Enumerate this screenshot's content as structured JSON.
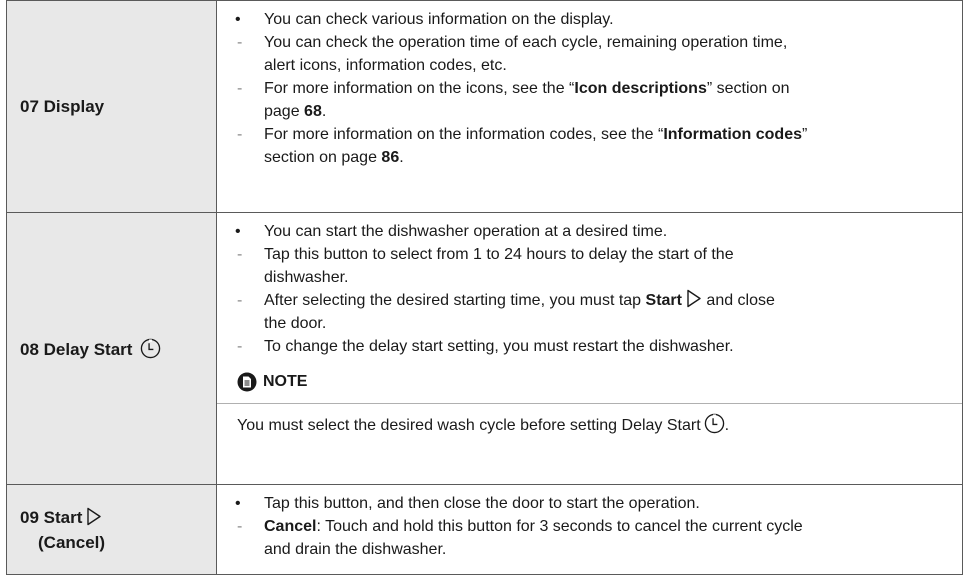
{
  "rows": [
    {
      "label": "07 Display",
      "bullet": "You can check various information on the display.",
      "d1": "You can check the operation time of each cycle, remaining operation time,",
      "d1b": "alert icons, information codes, etc.",
      "d2a": "For more information on the icons, see the “",
      "d2bold": "Icon descriptions",
      "d2b": "” section on",
      "d2c": "page ",
      "d2page": "68",
      "d2d": ".",
      "d3a": "For more information on the information codes, see the “",
      "d3bold": "Information codes",
      "d3b": "”",
      "d3c": "section on page ",
      "d3page": "86",
      "d3d": "."
    },
    {
      "label": "08 Delay Start",
      "bullet": "You can start the dishwasher operation at a desired time.",
      "d1": "Tap this button to select from 1 to 24 hours to delay the start of the",
      "d1b": "dishwasher.",
      "d2a": "After selecting the desired starting time, you must tap ",
      "d2bold": "Start",
      "d2b": " and close",
      "d2c": "the door.",
      "d3": "To change the delay start setting, you must restart the dishwasher.",
      "note_title": "NOTE",
      "note_text": "You must select the desired wash cycle before setting Delay Start",
      "note_end": "."
    },
    {
      "label_line1": "09 Start",
      "label_line2": "(Cancel)",
      "bullet": "Tap this button, and then close the door to start the operation.",
      "d1bold": "Cancel",
      "d1": ": Touch and hold this button for 3 seconds to cancel the current cycle",
      "d1b": "and drain the dishwasher."
    }
  ],
  "icons": {
    "delay": "clock-icon",
    "start": "play-outline-icon",
    "note": "note-icon"
  }
}
